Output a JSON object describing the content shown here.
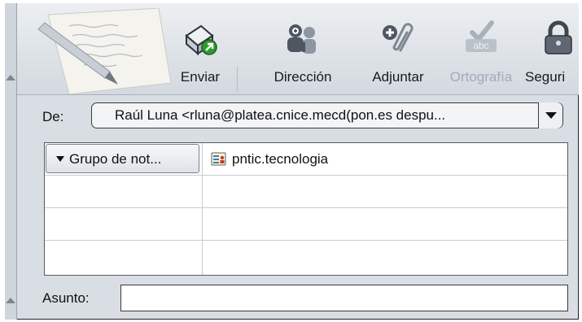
{
  "toolbar": {
    "buttons": [
      {
        "label": "Enviar",
        "icon": "send-icon",
        "enabled": true
      },
      {
        "label": "Dirección",
        "icon": "address-book-icon",
        "enabled": true
      },
      {
        "label": "Adjuntar",
        "icon": "attach-paperclip-icon",
        "enabled": true
      },
      {
        "label": "Ortografía",
        "icon": "spellcheck-icon",
        "enabled": false
      },
      {
        "label": "Seguri",
        "icon": "security-lock-icon",
        "enabled": true
      }
    ]
  },
  "from": {
    "label": "De:",
    "value": "Raúl Luna <rluna@platea.cnice.mecd(pon.es despu..."
  },
  "recipients": [
    {
      "type": "Grupo de not...",
      "address": "pntic.tecnologia",
      "icon": "newsgroup-icon"
    },
    {
      "type": "",
      "address": ""
    },
    {
      "type": "",
      "address": ""
    },
    {
      "type": "",
      "address": ""
    }
  ],
  "subject": {
    "label": "Asunto:",
    "value": ""
  },
  "colors": {
    "toolbar_bg": "#d3d9df",
    "frame_bg": "#d9dee4",
    "disabled_text": "#a2acb6"
  }
}
